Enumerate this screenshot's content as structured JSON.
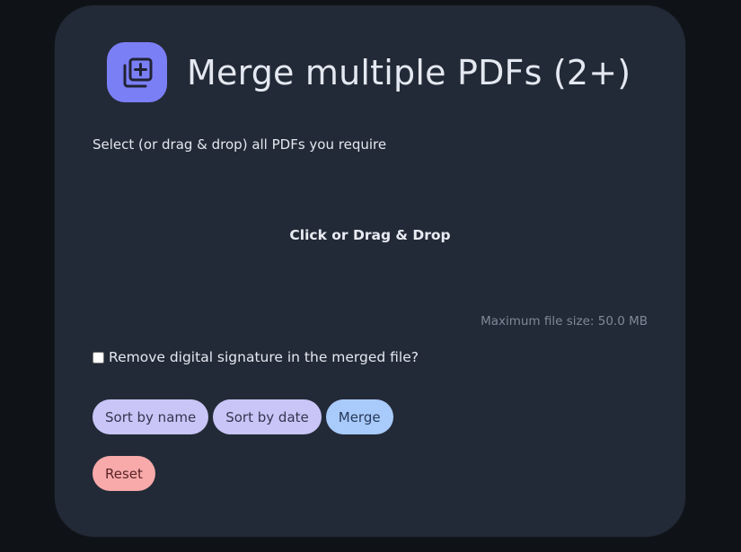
{
  "header": {
    "title": "Merge multiple PDFs (2+)",
    "logo_icon": "copy-plus-icon",
    "logo_color": "#7b7ff6"
  },
  "upload": {
    "instruction": "Select (or drag & drop) all PDFs you require",
    "dropzone_label": "Click or Drag & Drop",
    "max_file_size": "Maximum file size: 50.0 MB"
  },
  "options": {
    "remove_signature_label": "Remove digital signature in the merged file?",
    "remove_signature_checked": false
  },
  "actions": {
    "sort_by_name": "Sort by name",
    "sort_by_date": "Sort by date",
    "merge": "Merge",
    "reset": "Reset"
  },
  "colors": {
    "background": "#0f1318",
    "card": "#232a37",
    "sort_button": "#c9c5f6",
    "merge_button": "#a9cbfb",
    "reset_button": "#f7aaa9"
  }
}
